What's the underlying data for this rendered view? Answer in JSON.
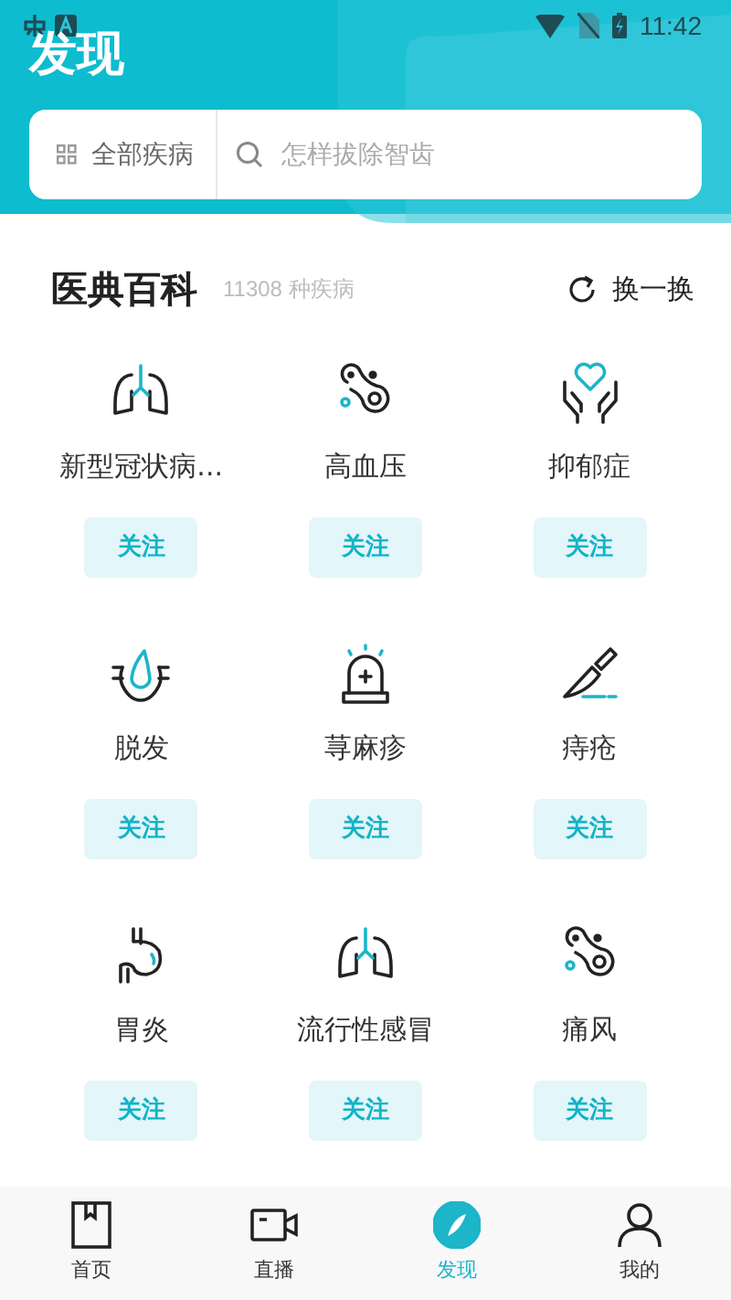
{
  "status_bar": {
    "time": "11:42"
  },
  "header": {
    "title": "发现",
    "category_button": "全部疾病",
    "search": {
      "placeholder": "怎样拔除智齿"
    }
  },
  "encyclopedia": {
    "title": "医典百科",
    "count": "11308 种疾病",
    "refresh": "换一换",
    "diseases": [
      {
        "name": "新型冠状病...",
        "kind": "lungs",
        "follow": "关注"
      },
      {
        "name": "高血压",
        "kind": "cells",
        "follow": "关注"
      },
      {
        "name": "抑郁症",
        "kind": "care",
        "follow": "关注"
      },
      {
        "name": "脱发",
        "kind": "hair",
        "follow": "关注"
      },
      {
        "name": "荨麻疹",
        "kind": "siren",
        "follow": "关注"
      },
      {
        "name": "痔疮",
        "kind": "knife",
        "follow": "关注"
      },
      {
        "name": "胃炎",
        "kind": "stomach",
        "follow": "关注"
      },
      {
        "name": "流行性感冒",
        "kind": "lungs",
        "follow": "关注"
      },
      {
        "name": "痛风",
        "kind": "cells",
        "follow": "关注"
      }
    ]
  },
  "bottom_nav": [
    {
      "label": "首页",
      "kind": "home",
      "selected": false
    },
    {
      "label": "直播",
      "kind": "live",
      "selected": false
    },
    {
      "label": "发现",
      "kind": "discover",
      "selected": true
    },
    {
      "label": "我的",
      "kind": "profile",
      "selected": false
    }
  ]
}
